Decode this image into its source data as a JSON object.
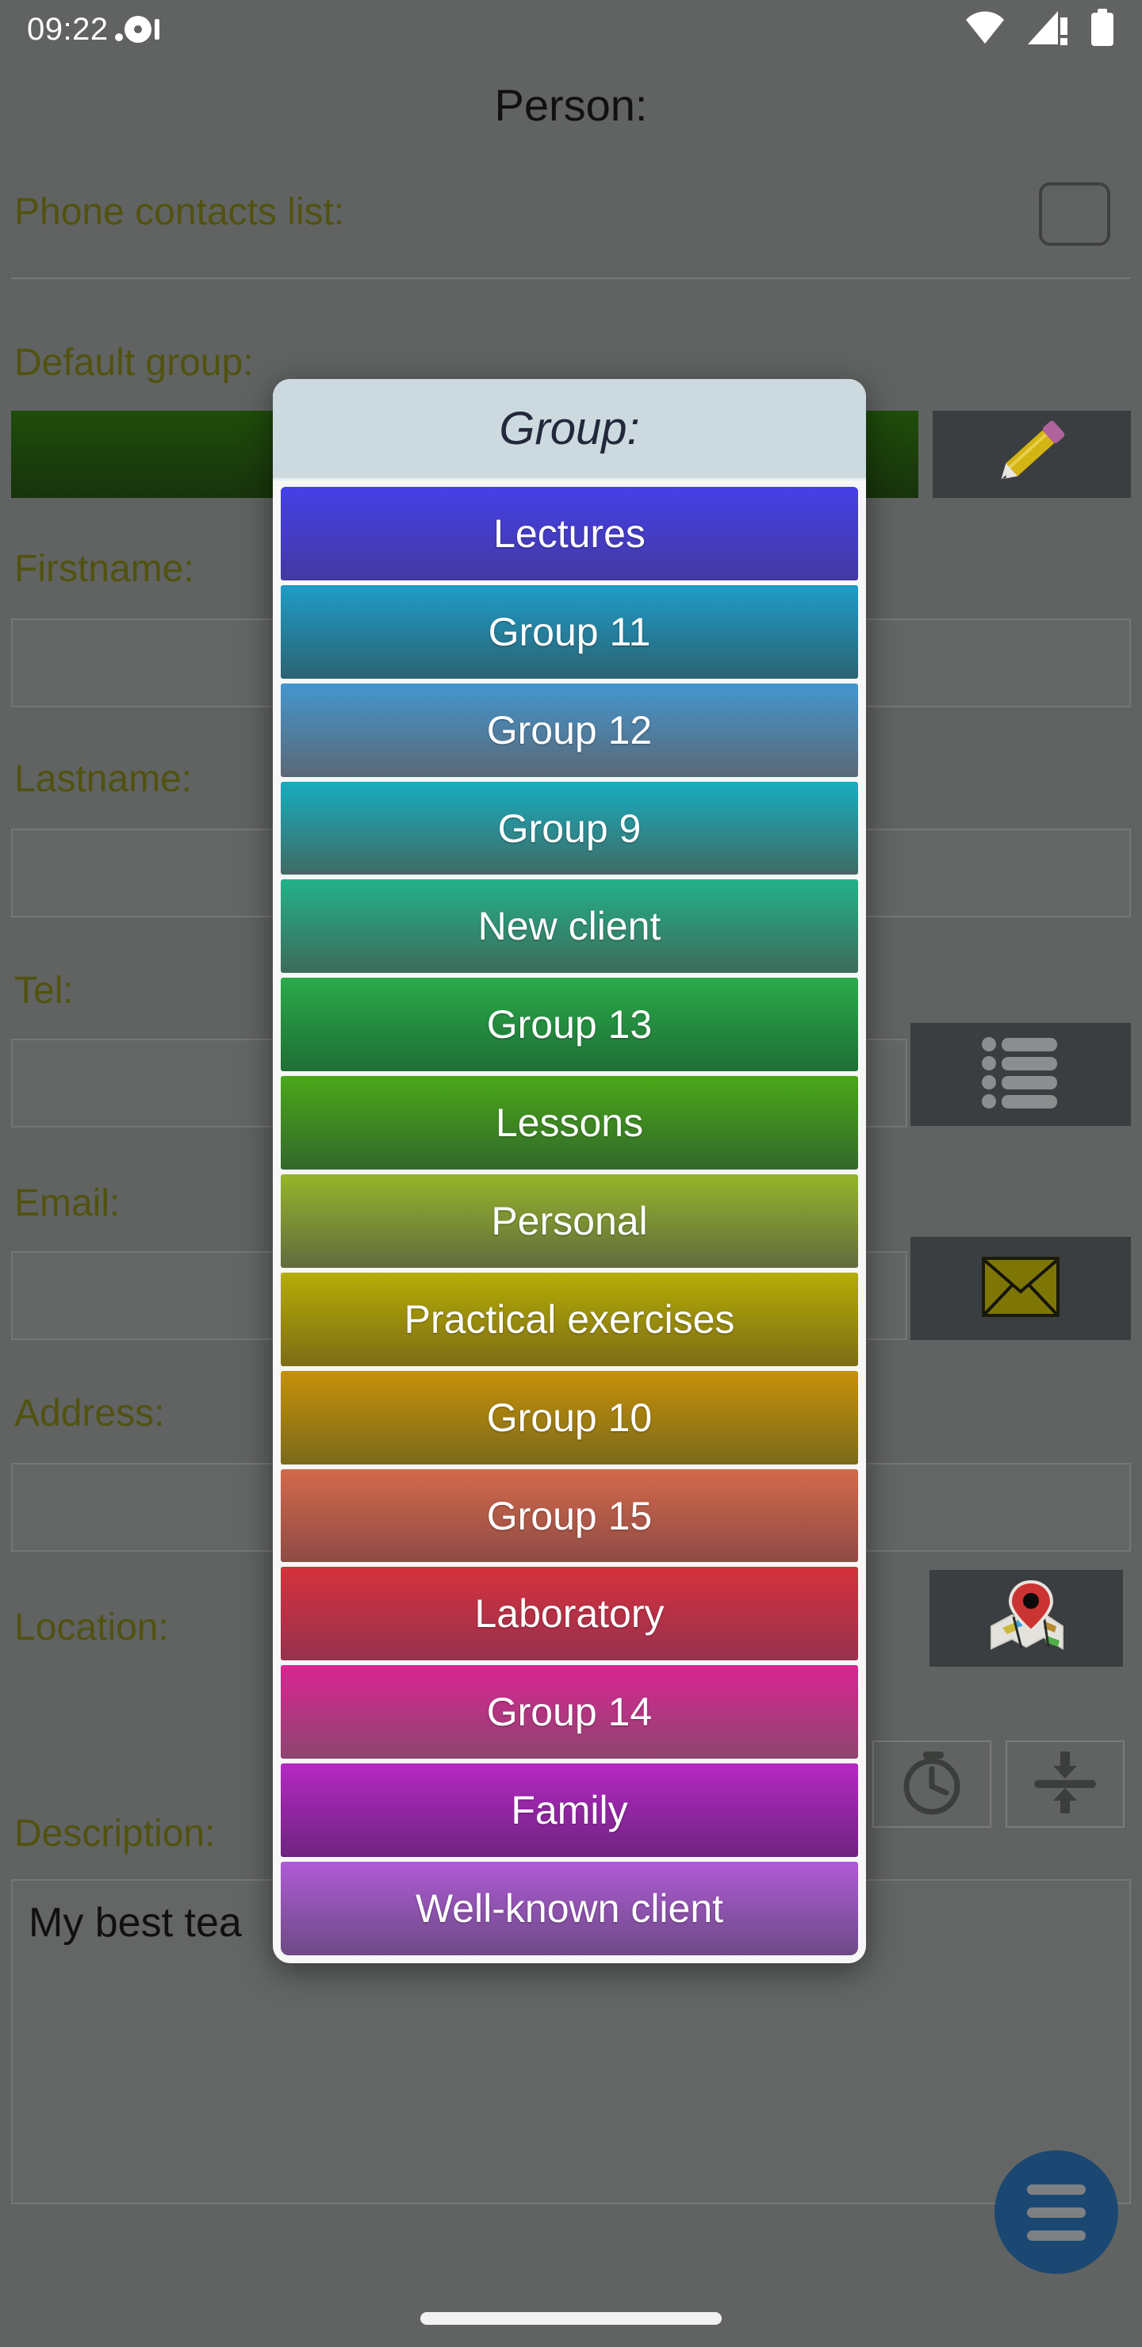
{
  "status_bar": {
    "time": "09:22",
    "left_icons": [
      "notification-dot-icon",
      "exclamation-icon"
    ],
    "right_icons": [
      "wifi-icon",
      "cellular-signal-warning-icon",
      "battery-full-icon"
    ]
  },
  "app": {
    "title": "Person:",
    "background_color": "#606362",
    "label_color": "#51520f"
  },
  "form": {
    "fields": [
      {
        "label": "Phone contacts list:",
        "type": "checkbox",
        "value": ""
      },
      {
        "label": "Default group:",
        "type": "color-swatch",
        "value": "",
        "swatch_color": "#1f4d0b",
        "action_icon": "pencil-icon"
      },
      {
        "label": "Firstname:",
        "type": "text",
        "value": ""
      },
      {
        "label": "Lastname:",
        "type": "text",
        "value": ""
      },
      {
        "label": "Tel:",
        "type": "text",
        "value": "",
        "action_icon": "list-icon"
      },
      {
        "label": "Email:",
        "type": "text",
        "value": "",
        "action_icon": "envelope-icon"
      },
      {
        "label": "Address:",
        "type": "text",
        "value": ""
      },
      {
        "label": "Location:",
        "type": "text",
        "value": "",
        "action_icon": "map-pin-icon"
      },
      {
        "label": "Description:",
        "type": "textarea",
        "value": "My best tea"
      }
    ],
    "tool_buttons": [
      {
        "icon": "stopwatch-icon",
        "label": ""
      },
      {
        "icon": "collapse-arrows-icon",
        "label": ""
      }
    ]
  },
  "fab": {
    "icon": "hamburger-menu-icon",
    "color": "#1b4872"
  },
  "dialog": {
    "title": "Group:",
    "header_color": "#ccdae0",
    "items": [
      {
        "label": "Lectures",
        "color_top": "#4540e8",
        "color_bottom": "#4339a2"
      },
      {
        "label": "Group 11",
        "color_top": "#1f9cc9",
        "color_bottom": "#2b6372"
      },
      {
        "label": "Group 12",
        "color_top": "#4396cf",
        "color_bottom": "#5b6876"
      },
      {
        "label": "Group 9",
        "color_top": "#17adc0",
        "color_bottom": "#3f6b64"
      },
      {
        "label": "New client",
        "color_top": "#23b189",
        "color_bottom": "#3d6b5b"
      },
      {
        "label": "Group 13",
        "color_top": "#29ab4a",
        "color_bottom": "#1f6e34"
      },
      {
        "label": "Lessons",
        "color_top": "#4aa818",
        "color_bottom": "#32682b"
      },
      {
        "label": "Personal",
        "color_top": "#96b52b",
        "color_bottom": "#616b3d"
      },
      {
        "label": "Practical exercises",
        "color_top": "#b5ad05",
        "color_bottom": "#7e6c16"
      },
      {
        "label": "Group 10",
        "color_top": "#c79108",
        "color_bottom": "#7a6a1b"
      },
      {
        "label": "Group 15",
        "color_top": "#d4694a",
        "color_bottom": "#8e4b45"
      },
      {
        "label": "Laboratory",
        "color_top": "#d6313c",
        "color_bottom": "#97314f"
      },
      {
        "label": "Group 14",
        "color_top": "#d92593",
        "color_bottom": "#8e4570"
      },
      {
        "label": "Family",
        "color_top": "#b628c4",
        "color_bottom": "#6e2480"
      },
      {
        "label": "Well-known client",
        "color_top": "#b05ad6",
        "color_bottom": "#6c4b85"
      }
    ]
  }
}
